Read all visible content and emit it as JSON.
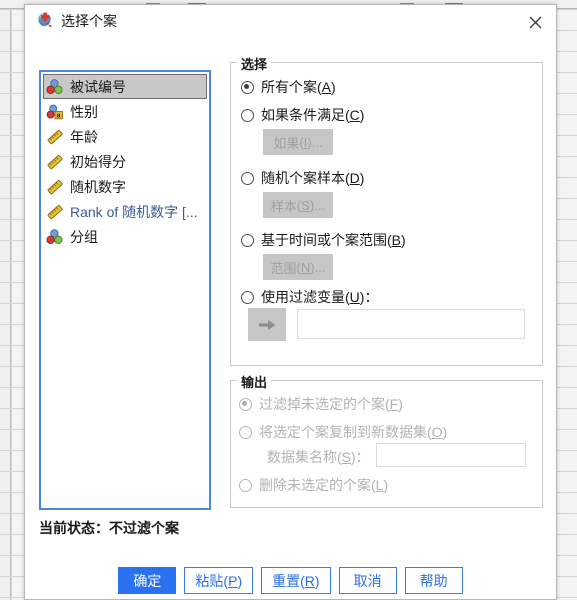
{
  "backdrop": {
    "name": "spss-data-editor-grid"
  },
  "dialog": {
    "title": "选择个案",
    "title_icon": "select-cases-icon",
    "close_icon": "close-icon"
  },
  "variable_list": {
    "name": "source-variable-list",
    "items": [
      {
        "label": "被试编号",
        "icon": "nominal-icon",
        "selected": true,
        "blue": false
      },
      {
        "label": "性别",
        "icon": "nominal-string-icon",
        "selected": false,
        "blue": false
      },
      {
        "label": "年龄",
        "icon": "scale-icon",
        "selected": false,
        "blue": false
      },
      {
        "label": "初始得分",
        "icon": "scale-icon",
        "selected": false,
        "blue": false
      },
      {
        "label": "随机数字",
        "icon": "scale-icon",
        "selected": false,
        "blue": false
      },
      {
        "label": "Rank of 随机数字 [...",
        "icon": "scale-icon",
        "selected": false,
        "blue": true
      },
      {
        "label": "分组",
        "icon": "nominal-icon",
        "selected": false,
        "blue": false
      }
    ]
  },
  "select_group": {
    "title": "选择",
    "options": [
      {
        "label": "所有个案",
        "mnemonic": "A",
        "checked": true,
        "disabled": false
      },
      {
        "label": "如果条件满足",
        "mnemonic": "C",
        "checked": false,
        "disabled": false
      },
      {
        "label": "随机个案样本",
        "mnemonic": "D",
        "checked": false,
        "disabled": false
      },
      {
        "label": "基于时间或个案范围",
        "mnemonic": "B",
        "checked": false,
        "disabled": false
      },
      {
        "label": "使用过滤变量",
        "mnemonic": "U",
        "checked": false,
        "disabled": false
      }
    ],
    "sub_buttons": [
      {
        "label": "如果",
        "mnemonic": "I",
        "suffix": "...",
        "disabled": true
      },
      {
        "label": "样本",
        "mnemonic": "S",
        "suffix": "...",
        "disabled": true
      },
      {
        "label": "范围",
        "mnemonic": "N",
        "suffix": "...",
        "disabled": true
      }
    ],
    "filter_arrow_icon": "right-arrow-icon",
    "filter_variable_value": "",
    "filter_variable_placeholder": ""
  },
  "output_group": {
    "title": "输出",
    "options": [
      {
        "label": "过滤掉未选定的个案",
        "mnemonic": "F",
        "checked": true,
        "disabled": true
      },
      {
        "label": "将选定个案复制到新数据集",
        "mnemonic": "O",
        "checked": false,
        "disabled": true
      },
      {
        "label": "删除未选定的个案",
        "mnemonic": "L",
        "checked": false,
        "disabled": true
      }
    ],
    "dataset_name_label": "数据集名称",
    "dataset_name_mnemonic": "S",
    "dataset_name_value": "",
    "dataset_name_placeholder": ""
  },
  "status": {
    "text": "当前状态：不过滤个案"
  },
  "buttons": [
    {
      "label": "确定",
      "mnemonic": "",
      "primary": true,
      "name": "ok-button"
    },
    {
      "label": "粘贴",
      "mnemonic": "P",
      "primary": false,
      "name": "paste-button"
    },
    {
      "label": "重置",
      "mnemonic": "R",
      "primary": false,
      "name": "reset-button"
    },
    {
      "label": "取消",
      "mnemonic": "",
      "primary": false,
      "name": "cancel-button"
    },
    {
      "label": "帮助",
      "mnemonic": "",
      "primary": false,
      "name": "help-button"
    }
  ],
  "colors": {
    "accent_blue": "#2a72f0",
    "list_border_blue": "#4a86e8",
    "selected_row_gray": "#c8c8c8",
    "disabled_text": "#b3b3b3",
    "nominal_blue": "#6f9fd8",
    "nominal_red": "#d83a3a",
    "nominal_green": "#7dc24b",
    "scale_gold": "#e8c23a"
  }
}
